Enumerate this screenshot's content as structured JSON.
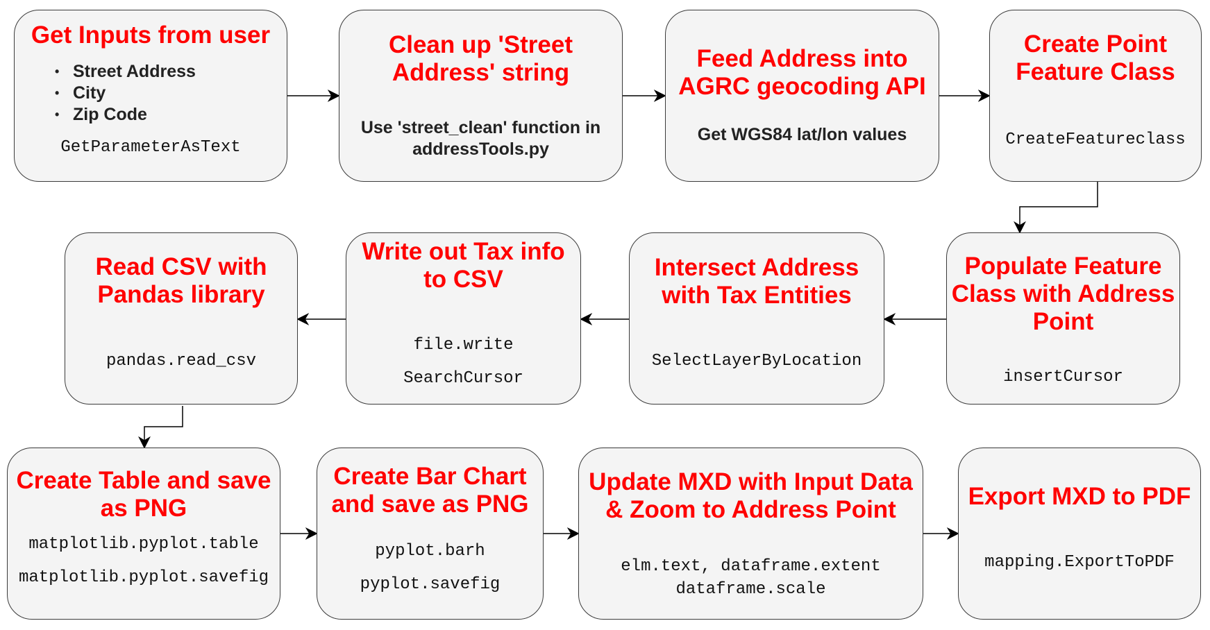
{
  "nodes": {
    "n1": {
      "title": [
        "Get Inputs from user"
      ],
      "bullets": [
        "Street Address",
        "City",
        "Zip Code"
      ],
      "code": [
        "GetParameterAsText"
      ]
    },
    "n2": {
      "title": [
        "Clean up 'Street",
        "Address' string"
      ],
      "text": [
        "Use 'street_clean' function in",
        "addressTools.py"
      ]
    },
    "n3": {
      "title": [
        "Feed Address into",
        "AGRC geocoding API"
      ],
      "text": [
        "Get WGS84 lat/lon values"
      ]
    },
    "n4": {
      "title": [
        "Create Point",
        "Feature Class"
      ],
      "code": [
        "CreateFeatureclass"
      ]
    },
    "n5": {
      "title": [
        "Populate Feature",
        "Class with Address",
        "Point"
      ],
      "code": [
        "insertCursor"
      ]
    },
    "n6": {
      "title": [
        "Intersect Address",
        "with Tax Entities"
      ],
      "code": [
        "SelectLayerByLocation"
      ]
    },
    "n7": {
      "title": [
        "Write out Tax info",
        "to CSV"
      ],
      "code": [
        "file.write",
        "SearchCursor"
      ]
    },
    "n8": {
      "title": [
        "Read CSV with",
        "Pandas library"
      ],
      "code": [
        "pandas.read_csv"
      ]
    },
    "n9": {
      "title": [
        "Create Table and save",
        "as PNG"
      ],
      "code": [
        "matplotlib.pyplot.table",
        "matplotlib.pyplot.savefig"
      ]
    },
    "n10": {
      "title": [
        "Create Bar Chart",
        "and save as PNG"
      ],
      "code": [
        "pyplot.barh",
        "pyplot.savefig"
      ]
    },
    "n11": {
      "title": [
        "Update MXD with Input Data",
        "& Zoom to Address Point"
      ],
      "code": [
        "elm.text, dataframe.extent",
        "dataframe.scale"
      ]
    },
    "n12": {
      "title": [
        "Export MXD to PDF"
      ],
      "code": [
        "mapping.ExportToPDF"
      ]
    }
  },
  "colors": {
    "title": "#ff0000",
    "box_fill": "#f4f4f4",
    "box_border": "#3a3a3a",
    "arrow": "#000000"
  }
}
